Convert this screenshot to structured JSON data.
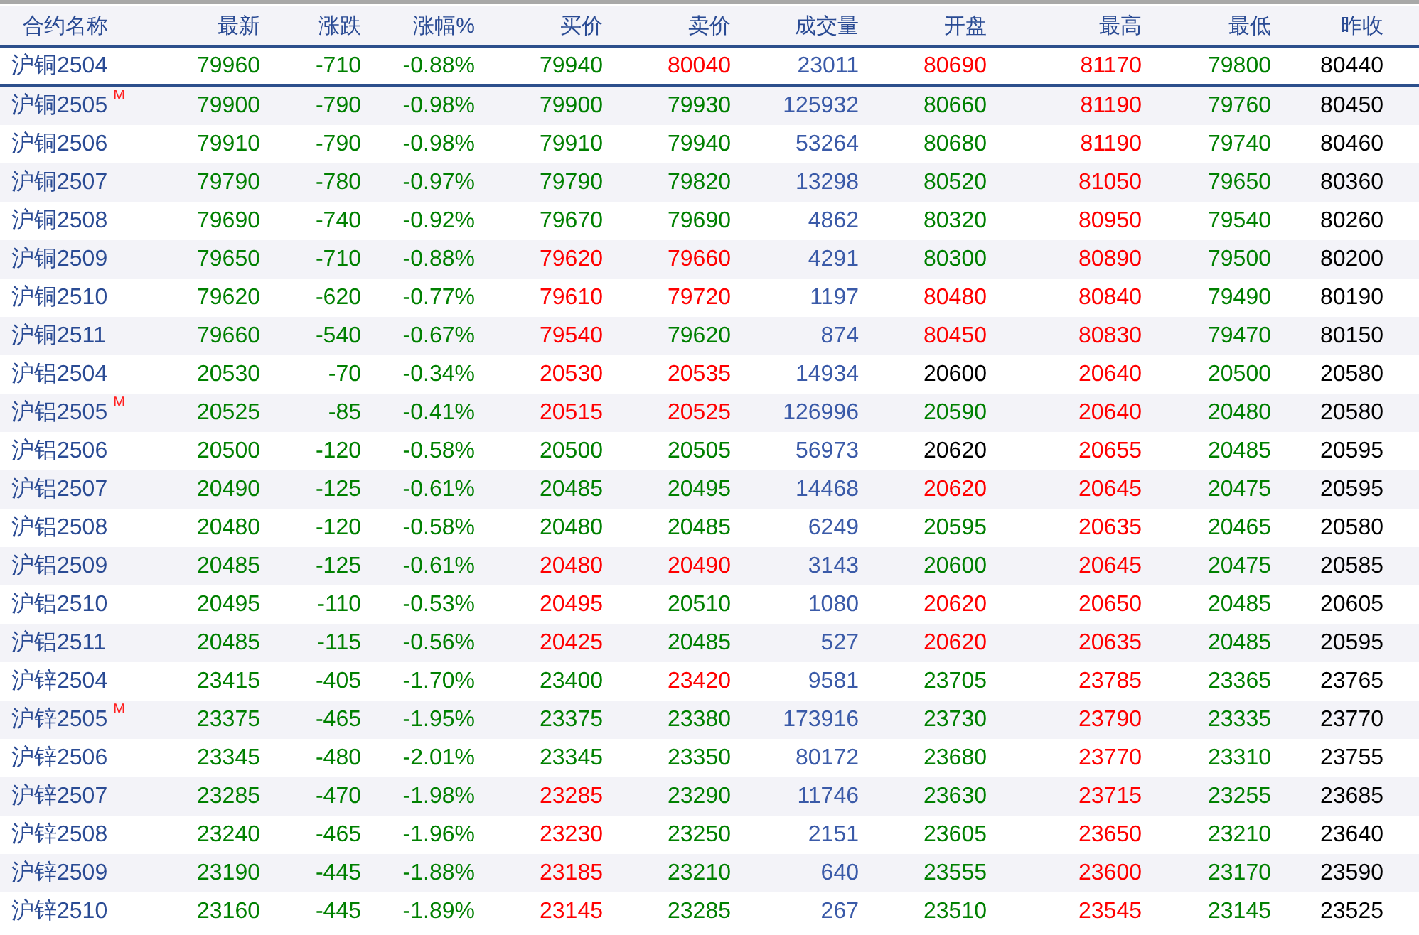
{
  "columns": [
    "合约名称",
    "最新",
    "涨跌",
    "涨幅%",
    "买价",
    "卖价",
    "成交量",
    "开盘",
    "最高",
    "最低",
    "昨收"
  ],
  "rows": [
    {
      "name": "沪铜2504",
      "selected": true,
      "cells": [
        {
          "value": "79960",
          "color": "#008000"
        },
        {
          "value": "-710",
          "color": "#008000"
        },
        {
          "value": "-0.88%",
          "color": "#008000"
        },
        {
          "value": "79940",
          "color": "#008000"
        },
        {
          "value": "80040",
          "color": "#ff0000"
        },
        {
          "value": "23011",
          "color": "#3a5aa8"
        },
        {
          "value": "80690",
          "color": "#ff0000"
        },
        {
          "value": "81170",
          "color": "#ff0000"
        },
        {
          "value": "79800",
          "color": "#008000"
        },
        {
          "value": "80440",
          "color": "#000000"
        }
      ]
    },
    {
      "name": "沪铜2505",
      "badge": "M",
      "selected": false,
      "cells": [
        {
          "value": "79900",
          "color": "#008000"
        },
        {
          "value": "-790",
          "color": "#008000"
        },
        {
          "value": "-0.98%",
          "color": "#008000"
        },
        {
          "value": "79900",
          "color": "#008000"
        },
        {
          "value": "79930",
          "color": "#008000"
        },
        {
          "value": "125932",
          "color": "#3a5aa8"
        },
        {
          "value": "80660",
          "color": "#008000"
        },
        {
          "value": "81190",
          "color": "#ff0000"
        },
        {
          "value": "79760",
          "color": "#008000"
        },
        {
          "value": "80450",
          "color": "#000000"
        }
      ]
    },
    {
      "name": "沪铜2506",
      "selected": false,
      "cells": [
        {
          "value": "79910",
          "color": "#008000"
        },
        {
          "value": "-790",
          "color": "#008000"
        },
        {
          "value": "-0.98%",
          "color": "#008000"
        },
        {
          "value": "79910",
          "color": "#008000"
        },
        {
          "value": "79940",
          "color": "#008000"
        },
        {
          "value": "53264",
          "color": "#3a5aa8"
        },
        {
          "value": "80680",
          "color": "#008000"
        },
        {
          "value": "81190",
          "color": "#ff0000"
        },
        {
          "value": "79740",
          "color": "#008000"
        },
        {
          "value": "80460",
          "color": "#000000"
        }
      ]
    },
    {
      "name": "沪铜2507",
      "selected": false,
      "cells": [
        {
          "value": "79790",
          "color": "#008000"
        },
        {
          "value": "-780",
          "color": "#008000"
        },
        {
          "value": "-0.97%",
          "color": "#008000"
        },
        {
          "value": "79790",
          "color": "#008000"
        },
        {
          "value": "79820",
          "color": "#008000"
        },
        {
          "value": "13298",
          "color": "#3a5aa8"
        },
        {
          "value": "80520",
          "color": "#008000"
        },
        {
          "value": "81050",
          "color": "#ff0000"
        },
        {
          "value": "79650",
          "color": "#008000"
        },
        {
          "value": "80360",
          "color": "#000000"
        }
      ]
    },
    {
      "name": "沪铜2508",
      "selected": false,
      "cells": [
        {
          "value": "79690",
          "color": "#008000"
        },
        {
          "value": "-740",
          "color": "#008000"
        },
        {
          "value": "-0.92%",
          "color": "#008000"
        },
        {
          "value": "79670",
          "color": "#008000"
        },
        {
          "value": "79690",
          "color": "#008000"
        },
        {
          "value": "4862",
          "color": "#3a5aa8"
        },
        {
          "value": "80320",
          "color": "#008000"
        },
        {
          "value": "80950",
          "color": "#ff0000"
        },
        {
          "value": "79540",
          "color": "#008000"
        },
        {
          "value": "80260",
          "color": "#000000"
        }
      ]
    },
    {
      "name": "沪铜2509",
      "selected": false,
      "cells": [
        {
          "value": "79650",
          "color": "#008000"
        },
        {
          "value": "-710",
          "color": "#008000"
        },
        {
          "value": "-0.88%",
          "color": "#008000"
        },
        {
          "value": "79620",
          "color": "#ff0000"
        },
        {
          "value": "79660",
          "color": "#ff0000"
        },
        {
          "value": "4291",
          "color": "#3a5aa8"
        },
        {
          "value": "80300",
          "color": "#008000"
        },
        {
          "value": "80890",
          "color": "#ff0000"
        },
        {
          "value": "79500",
          "color": "#008000"
        },
        {
          "value": "80200",
          "color": "#000000"
        }
      ]
    },
    {
      "name": "沪铜2510",
      "selected": false,
      "cells": [
        {
          "value": "79620",
          "color": "#008000"
        },
        {
          "value": "-620",
          "color": "#008000"
        },
        {
          "value": "-0.77%",
          "color": "#008000"
        },
        {
          "value": "79610",
          "color": "#ff0000"
        },
        {
          "value": "79720",
          "color": "#ff0000"
        },
        {
          "value": "1197",
          "color": "#3a5aa8"
        },
        {
          "value": "80480",
          "color": "#ff0000"
        },
        {
          "value": "80840",
          "color": "#ff0000"
        },
        {
          "value": "79490",
          "color": "#008000"
        },
        {
          "value": "80190",
          "color": "#000000"
        }
      ]
    },
    {
      "name": "沪铜2511",
      "selected": false,
      "cells": [
        {
          "value": "79660",
          "color": "#008000"
        },
        {
          "value": "-540",
          "color": "#008000"
        },
        {
          "value": "-0.67%",
          "color": "#008000"
        },
        {
          "value": "79540",
          "color": "#ff0000"
        },
        {
          "value": "79620",
          "color": "#008000"
        },
        {
          "value": "874",
          "color": "#3a5aa8"
        },
        {
          "value": "80450",
          "color": "#ff0000"
        },
        {
          "value": "80830",
          "color": "#ff0000"
        },
        {
          "value": "79470",
          "color": "#008000"
        },
        {
          "value": "80150",
          "color": "#000000"
        }
      ]
    },
    {
      "name": "沪铝2504",
      "selected": false,
      "cells": [
        {
          "value": "20530",
          "color": "#008000"
        },
        {
          "value": "-70",
          "color": "#008000"
        },
        {
          "value": "-0.34%",
          "color": "#008000"
        },
        {
          "value": "20530",
          "color": "#ff0000"
        },
        {
          "value": "20535",
          "color": "#ff0000"
        },
        {
          "value": "14934",
          "color": "#3a5aa8"
        },
        {
          "value": "20600",
          "color": "#000000"
        },
        {
          "value": "20640",
          "color": "#ff0000"
        },
        {
          "value": "20500",
          "color": "#008000"
        },
        {
          "value": "20580",
          "color": "#000000"
        }
      ]
    },
    {
      "name": "沪铝2505",
      "badge": "M",
      "selected": false,
      "cells": [
        {
          "value": "20525",
          "color": "#008000"
        },
        {
          "value": "-85",
          "color": "#008000"
        },
        {
          "value": "-0.41%",
          "color": "#008000"
        },
        {
          "value": "20515",
          "color": "#ff0000"
        },
        {
          "value": "20525",
          "color": "#ff0000"
        },
        {
          "value": "126996",
          "color": "#3a5aa8"
        },
        {
          "value": "20590",
          "color": "#008000"
        },
        {
          "value": "20640",
          "color": "#ff0000"
        },
        {
          "value": "20480",
          "color": "#008000"
        },
        {
          "value": "20580",
          "color": "#000000"
        }
      ]
    },
    {
      "name": "沪铝2506",
      "selected": false,
      "cells": [
        {
          "value": "20500",
          "color": "#008000"
        },
        {
          "value": "-120",
          "color": "#008000"
        },
        {
          "value": "-0.58%",
          "color": "#008000"
        },
        {
          "value": "20500",
          "color": "#008000"
        },
        {
          "value": "20505",
          "color": "#008000"
        },
        {
          "value": "56973",
          "color": "#3a5aa8"
        },
        {
          "value": "20620",
          "color": "#000000"
        },
        {
          "value": "20655",
          "color": "#ff0000"
        },
        {
          "value": "20485",
          "color": "#008000"
        },
        {
          "value": "20595",
          "color": "#000000"
        }
      ]
    },
    {
      "name": "沪铝2507",
      "selected": false,
      "cells": [
        {
          "value": "20490",
          "color": "#008000"
        },
        {
          "value": "-125",
          "color": "#008000"
        },
        {
          "value": "-0.61%",
          "color": "#008000"
        },
        {
          "value": "20485",
          "color": "#008000"
        },
        {
          "value": "20495",
          "color": "#008000"
        },
        {
          "value": "14468",
          "color": "#3a5aa8"
        },
        {
          "value": "20620",
          "color": "#ff0000"
        },
        {
          "value": "20645",
          "color": "#ff0000"
        },
        {
          "value": "20475",
          "color": "#008000"
        },
        {
          "value": "20595",
          "color": "#000000"
        }
      ]
    },
    {
      "name": "沪铝2508",
      "selected": false,
      "cells": [
        {
          "value": "20480",
          "color": "#008000"
        },
        {
          "value": "-120",
          "color": "#008000"
        },
        {
          "value": "-0.58%",
          "color": "#008000"
        },
        {
          "value": "20480",
          "color": "#008000"
        },
        {
          "value": "20485",
          "color": "#008000"
        },
        {
          "value": "6249",
          "color": "#3a5aa8"
        },
        {
          "value": "20595",
          "color": "#008000"
        },
        {
          "value": "20635",
          "color": "#ff0000"
        },
        {
          "value": "20465",
          "color": "#008000"
        },
        {
          "value": "20580",
          "color": "#000000"
        }
      ]
    },
    {
      "name": "沪铝2509",
      "selected": false,
      "cells": [
        {
          "value": "20485",
          "color": "#008000"
        },
        {
          "value": "-125",
          "color": "#008000"
        },
        {
          "value": "-0.61%",
          "color": "#008000"
        },
        {
          "value": "20480",
          "color": "#ff0000"
        },
        {
          "value": "20490",
          "color": "#ff0000"
        },
        {
          "value": "3143",
          "color": "#3a5aa8"
        },
        {
          "value": "20600",
          "color": "#008000"
        },
        {
          "value": "20645",
          "color": "#ff0000"
        },
        {
          "value": "20475",
          "color": "#008000"
        },
        {
          "value": "20585",
          "color": "#000000"
        }
      ]
    },
    {
      "name": "沪铝2510",
      "selected": false,
      "cells": [
        {
          "value": "20495",
          "color": "#008000"
        },
        {
          "value": "-110",
          "color": "#008000"
        },
        {
          "value": "-0.53%",
          "color": "#008000"
        },
        {
          "value": "20495",
          "color": "#ff0000"
        },
        {
          "value": "20510",
          "color": "#008000"
        },
        {
          "value": "1080",
          "color": "#3a5aa8"
        },
        {
          "value": "20620",
          "color": "#ff0000"
        },
        {
          "value": "20650",
          "color": "#ff0000"
        },
        {
          "value": "20485",
          "color": "#008000"
        },
        {
          "value": "20605",
          "color": "#000000"
        }
      ]
    },
    {
      "name": "沪铝2511",
      "selected": false,
      "cells": [
        {
          "value": "20485",
          "color": "#008000"
        },
        {
          "value": "-115",
          "color": "#008000"
        },
        {
          "value": "-0.56%",
          "color": "#008000"
        },
        {
          "value": "20425",
          "color": "#ff0000"
        },
        {
          "value": "20485",
          "color": "#008000"
        },
        {
          "value": "527",
          "color": "#3a5aa8"
        },
        {
          "value": "20620",
          "color": "#ff0000"
        },
        {
          "value": "20635",
          "color": "#ff0000"
        },
        {
          "value": "20485",
          "color": "#008000"
        },
        {
          "value": "20595",
          "color": "#000000"
        }
      ]
    },
    {
      "name": "沪锌2504",
      "selected": false,
      "cells": [
        {
          "value": "23415",
          "color": "#008000"
        },
        {
          "value": "-405",
          "color": "#008000"
        },
        {
          "value": "-1.70%",
          "color": "#008000"
        },
        {
          "value": "23400",
          "color": "#008000"
        },
        {
          "value": "23420",
          "color": "#ff0000"
        },
        {
          "value": "9581",
          "color": "#3a5aa8"
        },
        {
          "value": "23705",
          "color": "#008000"
        },
        {
          "value": "23785",
          "color": "#ff0000"
        },
        {
          "value": "23365",
          "color": "#008000"
        },
        {
          "value": "23765",
          "color": "#000000"
        }
      ]
    },
    {
      "name": "沪锌2505",
      "badge": "M",
      "selected": false,
      "cells": [
        {
          "value": "23375",
          "color": "#008000"
        },
        {
          "value": "-465",
          "color": "#008000"
        },
        {
          "value": "-1.95%",
          "color": "#008000"
        },
        {
          "value": "23375",
          "color": "#008000"
        },
        {
          "value": "23380",
          "color": "#008000"
        },
        {
          "value": "173916",
          "color": "#3a5aa8"
        },
        {
          "value": "23730",
          "color": "#008000"
        },
        {
          "value": "23790",
          "color": "#ff0000"
        },
        {
          "value": "23335",
          "color": "#008000"
        },
        {
          "value": "23770",
          "color": "#000000"
        }
      ]
    },
    {
      "name": "沪锌2506",
      "selected": false,
      "cells": [
        {
          "value": "23345",
          "color": "#008000"
        },
        {
          "value": "-480",
          "color": "#008000"
        },
        {
          "value": "-2.01%",
          "color": "#008000"
        },
        {
          "value": "23345",
          "color": "#008000"
        },
        {
          "value": "23350",
          "color": "#008000"
        },
        {
          "value": "80172",
          "color": "#3a5aa8"
        },
        {
          "value": "23680",
          "color": "#008000"
        },
        {
          "value": "23770",
          "color": "#ff0000"
        },
        {
          "value": "23310",
          "color": "#008000"
        },
        {
          "value": "23755",
          "color": "#000000"
        }
      ]
    },
    {
      "name": "沪锌2507",
      "selected": false,
      "cells": [
        {
          "value": "23285",
          "color": "#008000"
        },
        {
          "value": "-470",
          "color": "#008000"
        },
        {
          "value": "-1.98%",
          "color": "#008000"
        },
        {
          "value": "23285",
          "color": "#ff0000"
        },
        {
          "value": "23290",
          "color": "#008000"
        },
        {
          "value": "11746",
          "color": "#3a5aa8"
        },
        {
          "value": "23630",
          "color": "#008000"
        },
        {
          "value": "23715",
          "color": "#ff0000"
        },
        {
          "value": "23255",
          "color": "#008000"
        },
        {
          "value": "23685",
          "color": "#000000"
        }
      ]
    },
    {
      "name": "沪锌2508",
      "selected": false,
      "cells": [
        {
          "value": "23240",
          "color": "#008000"
        },
        {
          "value": "-465",
          "color": "#008000"
        },
        {
          "value": "-1.96%",
          "color": "#008000"
        },
        {
          "value": "23230",
          "color": "#ff0000"
        },
        {
          "value": "23250",
          "color": "#008000"
        },
        {
          "value": "2151",
          "color": "#3a5aa8"
        },
        {
          "value": "23605",
          "color": "#008000"
        },
        {
          "value": "23650",
          "color": "#ff0000"
        },
        {
          "value": "23210",
          "color": "#008000"
        },
        {
          "value": "23640",
          "color": "#000000"
        }
      ]
    },
    {
      "name": "沪锌2509",
      "selected": false,
      "cells": [
        {
          "value": "23190",
          "color": "#008000"
        },
        {
          "value": "-445",
          "color": "#008000"
        },
        {
          "value": "-1.88%",
          "color": "#008000"
        },
        {
          "value": "23185",
          "color": "#ff0000"
        },
        {
          "value": "23210",
          "color": "#008000"
        },
        {
          "value": "640",
          "color": "#3a5aa8"
        },
        {
          "value": "23555",
          "color": "#008000"
        },
        {
          "value": "23600",
          "color": "#ff0000"
        },
        {
          "value": "23170",
          "color": "#008000"
        },
        {
          "value": "23590",
          "color": "#000000"
        }
      ]
    },
    {
      "name": "沪锌2510",
      "selected": false,
      "cells": [
        {
          "value": "23160",
          "color": "#008000"
        },
        {
          "value": "-445",
          "color": "#008000"
        },
        {
          "value": "-1.89%",
          "color": "#008000"
        },
        {
          "value": "23145",
          "color": "#ff0000"
        },
        {
          "value": "23285",
          "color": "#008000"
        },
        {
          "value": "267",
          "color": "#3a5aa8"
        },
        {
          "value": "23510",
          "color": "#008000"
        },
        {
          "value": "23545",
          "color": "#ff0000"
        },
        {
          "value": "23145",
          "color": "#008000"
        },
        {
          "value": "23525",
          "color": "#000000"
        }
      ]
    }
  ]
}
